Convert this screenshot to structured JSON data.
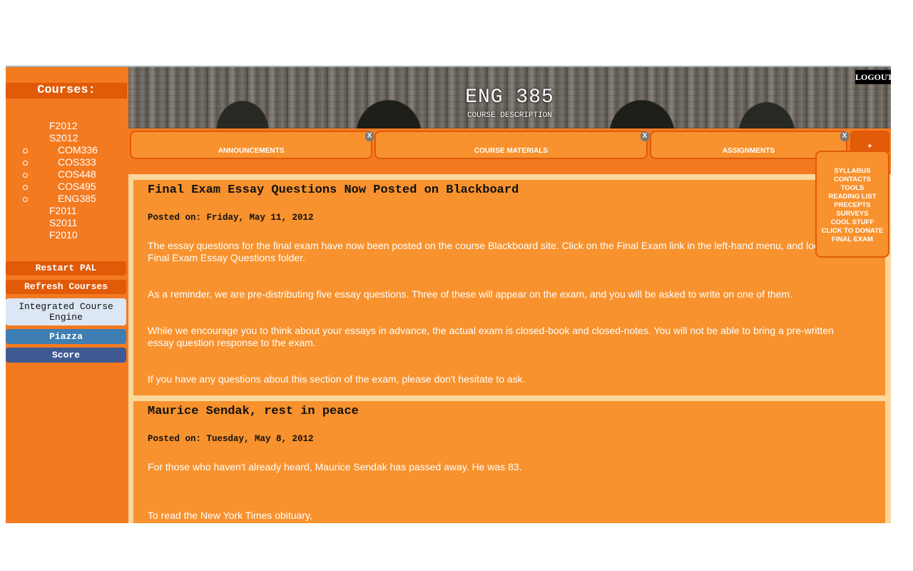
{
  "sidebar": {
    "heading": "Courses:",
    "terms": [
      {
        "label": "F2012"
      },
      {
        "label": "S2012"
      },
      {
        "label": "COM336"
      },
      {
        "label": "COS333"
      },
      {
        "label": "COS448"
      },
      {
        "label": "COS495"
      },
      {
        "label": "ENG385"
      },
      {
        "label": "F2011"
      },
      {
        "label": "S2011"
      },
      {
        "label": "F2010"
      }
    ],
    "buttons": {
      "restart": "Restart PAL",
      "refresh": "Refresh Courses",
      "ice": "Integrated Course Engine",
      "piazza": "Piazza",
      "score": "Score"
    }
  },
  "header": {
    "title": "ENG 385",
    "subtitle": "COURSE DESCRIPTION",
    "logout": "LOGOUT"
  },
  "tabs": [
    {
      "label": "ANNOUNCEMENTS",
      "close": "X"
    },
    {
      "label": "COURSE MATERIALS",
      "close": "X"
    },
    {
      "label": "ASSIGNMENTS",
      "close": "X"
    }
  ],
  "more": {
    "button": "+",
    "items": [
      "SYLLABUS",
      "CONTACTS",
      "TOOLS",
      "READING LIST",
      "PRECEPTS",
      "SURVEYS",
      "COOL STUFF",
      "CLICK TO DONATE",
      "FINAL EXAM"
    ]
  },
  "posts": [
    {
      "title": "Final Exam Essay Questions Now Posted on Blackboard",
      "date": "Posted on: Friday, May 11, 2012",
      "paragraphs": [
        "The essay questions for the final exam have now been posted on the course Blackboard site. Click on the Final Exam link in the left-hand menu, and look in the Final Exam Essay Questions folder.",
        "As a reminder, we are pre-distributing five essay questions. Three of these will appear on the exam, and you will be asked to write on one of them.",
        "While we encourage you to think about your essays in advance, the actual exam is closed-book and closed-notes. You will not be able to bring a pre-written essay question response to the exam.",
        "If you have any questions about this section of the exam, please don't hesitate to ask."
      ]
    },
    {
      "title": "Maurice Sendak, rest in peace",
      "date": "Posted on: Tuesday, May 8, 2012",
      "paragraphs": [
        "For those who haven't already heard, Maurice Sendak has passed away. He was 83.",
        "To read the New York Times obituary,"
      ]
    }
  ],
  "colors": {
    "background": "#f47a20",
    "post": "#f7922e",
    "accent_dark": "#e05a08",
    "content_backdrop": "#fbd79a",
    "piazza": "#3e7eb3",
    "score": "#3f5a92"
  }
}
